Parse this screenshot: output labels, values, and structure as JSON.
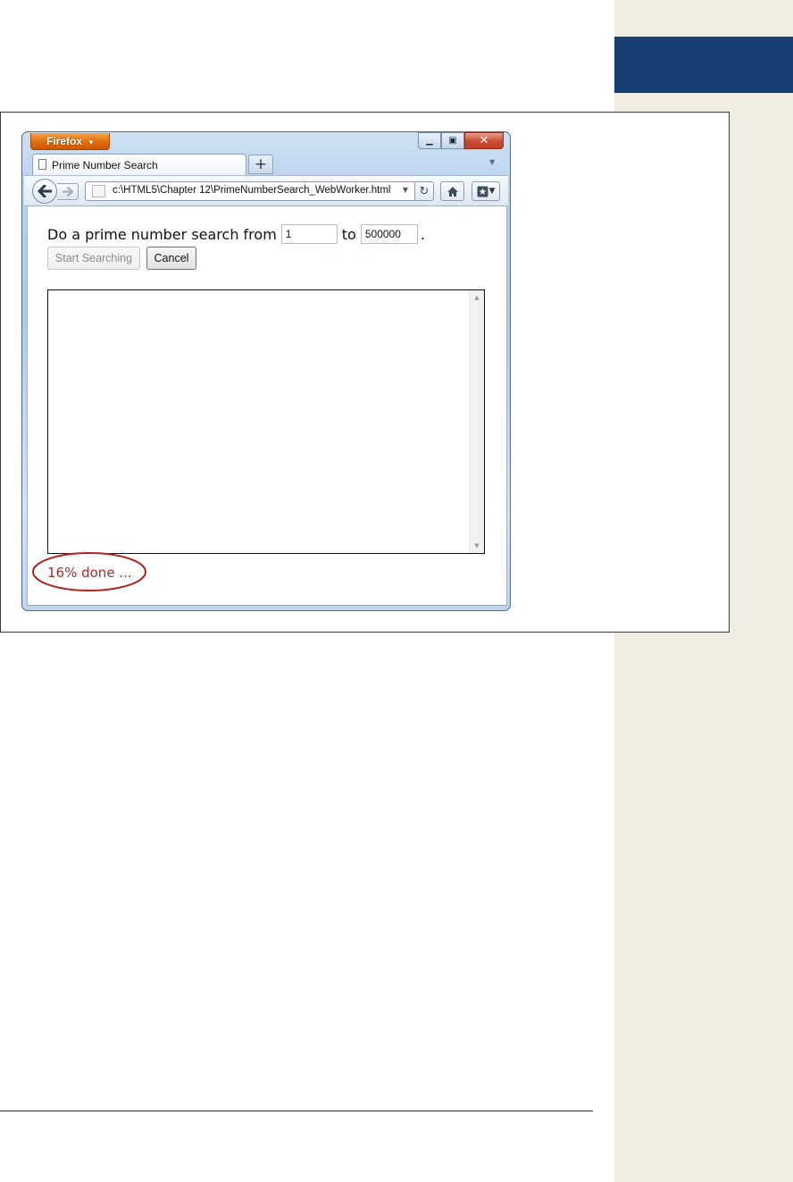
{
  "browser": {
    "app_button": "Firefox",
    "tab_title": "Prime Number Search",
    "new_tab_symbol": "+",
    "url": "c:\\HTML5\\Chapter 12\\PrimeNumberSearch_WebWorker.html"
  },
  "page": {
    "prompt_text": "Do a prime number search from",
    "from_value": "1",
    "to_label": "to",
    "to_value": "500000",
    "period": ".",
    "start_button": "Start Searching",
    "cancel_button": "Cancel",
    "status": "16% done ..."
  },
  "colors": {
    "sidebar": "#f0ece1",
    "sidebar_tab": "#163f73",
    "status_text": "#a52a2a",
    "callout": "#b22222"
  },
  "icons": [
    "page-icon",
    "back-arrow-icon",
    "forward-arrow-icon",
    "reload-icon",
    "home-icon",
    "bookmarks-star-icon",
    "dropdown-icon"
  ]
}
